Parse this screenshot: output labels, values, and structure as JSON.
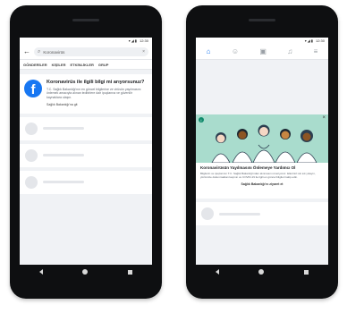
{
  "status_bar": {
    "icons": "▾◢▮",
    "time": "12:30"
  },
  "left_screen": {
    "search": {
      "query": "Koronavirüs"
    },
    "tabs": [
      "GÖNDERİLER",
      "KİŞİLER",
      "ETKİNLİKLER",
      "GRUP"
    ],
    "info_card": {
      "title": "Koronavirüs ile ilgili bilgi mi arıyorsunuz?",
      "body": "T.C. Sağlık Bakanlığı'nın en güncel bilgilerine ve virüsün yayılmasını önlemek amacıyla alınan tedbirlere dair ipuçlarına ve güvenilir kaynaklara ulaşın.",
      "link": "Sağlık Bakanlığı'na git"
    },
    "placeholder_count": 3
  },
  "right_screen": {
    "banner": {
      "title": "Koronavirüsün Yayılmasını Önlemeye Yardımcı Ol",
      "body": "Bilgilerin ve ipuçlarının T.C. Sağlık Bakanlığı'ndan alınmasını öneriyoruz. Ellerinizi sık sık yıkayın, yüzünüze dokunmaktan kaçının ve COVID-19 ile ilgili en güncel bilgileri takip edin.",
      "link": "Sağlık Bakanlığı'nı ziyaret et"
    }
  },
  "colors": {
    "facebook_blue": "#1877f2",
    "banner_teal": "#a9dccd",
    "phone_body": "#0e0f11"
  }
}
